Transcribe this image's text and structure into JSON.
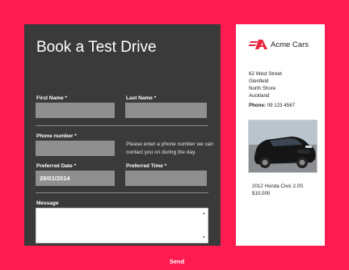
{
  "form": {
    "title": "Book a Test Drive",
    "first_name_label": "First Name *",
    "last_name_label": "Last Name *",
    "phone_label": "Phone number *",
    "phone_help": "Please enter a phone number we can contact you on during the day.",
    "date_label": "Preferred Date *",
    "date_value": "28/01/2014",
    "time_label": "Preferred Time *",
    "message_label": "Message",
    "send_label": "Send"
  },
  "dealer": {
    "name": "Acme Cars",
    "address": [
      "62 West Street",
      "Glenfield",
      "North Shore",
      "Auckland"
    ],
    "phone_label": "Phone:",
    "phone_value": "09 123 4567",
    "car_title": "2012 Honda Civic 2.0S",
    "car_price": "$10,000"
  },
  "colors": {
    "accent": "#ff1a4f",
    "panel_dark": "#3a3a3a",
    "field_bg": "#8f8f8f"
  }
}
